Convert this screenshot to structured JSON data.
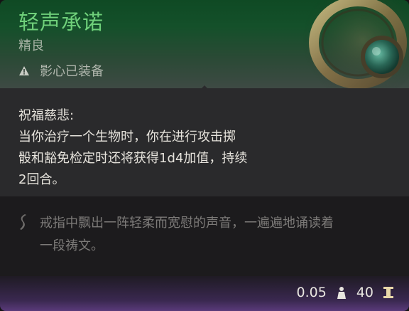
{
  "item": {
    "name": "轻声承诺",
    "rarity": "精良",
    "warning": "影心已装备"
  },
  "description": {
    "heading": "祝福慈悲:",
    "line1": "当你治疗一个生物时，你在进行攻击掷",
    "line2": "骰和豁免检定时还将获得1d4加值，持续",
    "line3": "2回合。"
  },
  "flavor": {
    "line1": "戒指中飘出一阵轻柔而宽慰的声音，一遍遍地诵读着",
    "line2": "一段祷文。"
  },
  "stats": {
    "weight": "0.05",
    "value": "40"
  },
  "icons": {
    "warning": "warning-triangle-icon",
    "flavor": "scroll-icon",
    "weight": "weight-icon",
    "value": "gold-coin-icon",
    "item": "ring-image"
  }
}
